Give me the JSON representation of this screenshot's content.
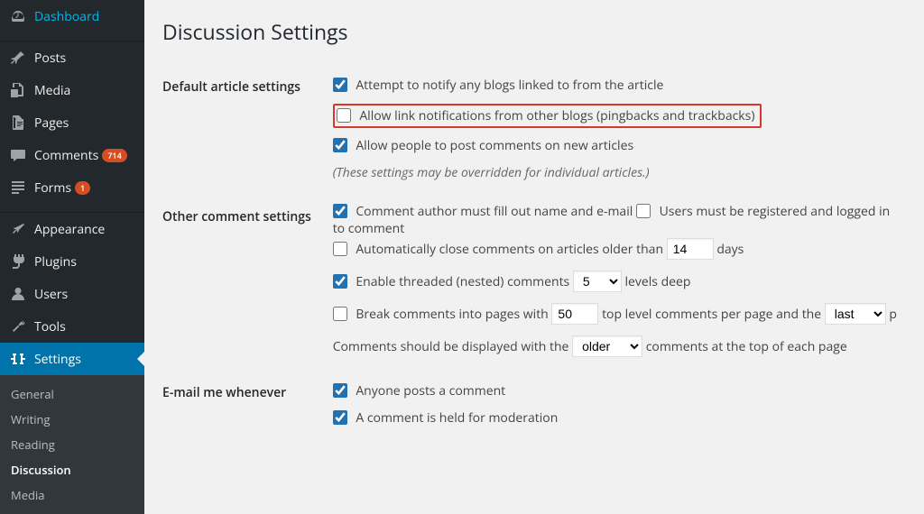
{
  "sidebar": {
    "main": [
      {
        "label": "Dashboard",
        "icon": "dashboard"
      },
      {
        "label": "Posts",
        "icon": "pin"
      },
      {
        "label": "Media",
        "icon": "media"
      },
      {
        "label": "Pages",
        "icon": "pages"
      },
      {
        "label": "Comments",
        "icon": "comments",
        "badge": "714"
      },
      {
        "label": "Forms",
        "icon": "forms",
        "badge": "1"
      },
      {
        "label": "Appearance",
        "icon": "appearance"
      },
      {
        "label": "Plugins",
        "icon": "plugins"
      },
      {
        "label": "Users",
        "icon": "users"
      },
      {
        "label": "Tools",
        "icon": "tools"
      },
      {
        "label": "Settings",
        "icon": "settings",
        "active": true
      }
    ],
    "submenu": [
      {
        "label": "General"
      },
      {
        "label": "Writing"
      },
      {
        "label": "Reading"
      },
      {
        "label": "Discussion",
        "current": true
      },
      {
        "label": "Media"
      }
    ]
  },
  "page": {
    "title": "Discussion Settings",
    "sections": {
      "default_article": {
        "heading": "Default article settings",
        "opt_notify_linked": "Attempt to notify any blogs linked to from the article",
        "opt_allow_pingbacks": "Allow link notifications from other blogs (pingbacks and trackbacks)",
        "opt_allow_comments": "Allow people to post comments on new articles",
        "note": "(These settings may be overridden for individual articles.)"
      },
      "other_comment": {
        "heading": "Other comment settings",
        "opt_name_email": "Comment author must fill out name and e-mail",
        "opt_registered": "Users must be registered and logged in to comment",
        "opt_autoclose_before": "Automatically close comments on articles older than",
        "autoclose_days_value": "14",
        "opt_autoclose_after": "days",
        "opt_threaded_before": "Enable threaded (nested) comments",
        "threaded_levels_value": "5",
        "opt_threaded_after": "levels deep",
        "opt_paging_before": "Break comments into pages with",
        "paging_value": "50",
        "opt_paging_mid": "top level comments per page and the",
        "paging_order_value": "last",
        "opt_paging_after_trunc": "p",
        "display_before": "Comments should be displayed with the",
        "display_order_value": "older",
        "display_after": "comments at the top of each page"
      },
      "email_whenever": {
        "heading": "E-mail me whenever",
        "opt_anyone_posts": "Anyone posts a comment",
        "opt_held_moderation": "A comment is held for moderation"
      }
    }
  }
}
